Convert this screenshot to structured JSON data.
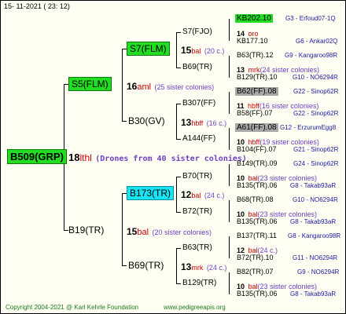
{
  "header": {
    "date": "15- 11-2021 ( 23: 12)"
  },
  "footer": {
    "copyright": "Copyright 2004-2021 @ Karl Kehrle Foundation",
    "site": "www.pedigreeapis.org"
  },
  "root": {
    "name": "B509(GRP)",
    "num": "18",
    "lab": "lthl",
    "drones": "(Drones from 40 sister colonies)"
  },
  "gen2": [
    {
      "name": "S5(FLM)",
      "num": "16",
      "lab": "aml",
      "ann": "(25 sister colonies)"
    },
    {
      "name": "B19(TR)",
      "num": "15",
      "lab": "bal",
      "ann": "(20 sister colonies)"
    }
  ],
  "gen3": [
    {
      "name": "S7(FLM)",
      "num": "15",
      "lab": "bal",
      "ann": "(20 c.)"
    },
    {
      "name": "B30(GV)",
      "num": "13",
      "lab": "hbff",
      "ann": "(16 c.)"
    },
    {
      "name": "B173(TR)",
      "num": "12",
      "lab": "bal",
      "ann": "(24 c.)"
    },
    {
      "name": "B69(TR)",
      "num": "13",
      "lab": "mrk",
      "ann": "(24 c.)"
    }
  ],
  "gen4": [
    {
      "name": "S7(FJO)",
      "num": "14",
      "lab": "oro",
      "ann": ""
    },
    {
      "name": "B69(TR)",
      "num": "13",
      "lab": "mrk",
      "ann": "(24 sister colonies)"
    },
    {
      "name": "B307(FF)",
      "num": "11",
      "lab": "hbff",
      "ann": "(16 sister colonies)"
    },
    {
      "name": "A144(FF)",
      "num": "10",
      "lab": "hbff",
      "ann": "(19 sister colonies)"
    },
    {
      "name": "B70(TR)",
      "num": "10",
      "lab": "bal",
      "ann": "(23 sister colonies)"
    },
    {
      "name": "B72(TR)",
      "num": "10",
      "lab": "bal",
      "ann": "(23 sister colonies)"
    },
    {
      "name": "B63(TR)",
      "num": "12",
      "lab": "bal",
      "ann": "(24 c.)"
    },
    {
      "name": "B129(TR)",
      "num": "10",
      "lab": "bal",
      "ann": "(23 sister colonies)"
    }
  ],
  "gen5": [
    {
      "name": "KB202.10",
      "right": "G3 - Erfoud07-1Q"
    },
    {
      "name": "KB177.10",
      "right": "G6 - Ankar02Q"
    },
    {
      "name": "B63(TR).12",
      "right": "G9 - Kangaroo98R"
    },
    {
      "name": "B129(TR).10",
      "right": "G10 - NO6294R"
    },
    {
      "name": "B62(FF).08",
      "right": "G22 - Sinop62R"
    },
    {
      "name": "B58(FF).07",
      "right": "G22 - Sinop62R"
    },
    {
      "name": "A61(FF).08",
      "right": "G12 - ErzurumEgg8"
    },
    {
      "name": "B104(FF).07",
      "right": "G21 - Sinop62R"
    },
    {
      "name": "B149(TR).09",
      "right": "G24 - Sinop62R"
    },
    {
      "name": "B135(TR).06",
      "right": "G8 - Takab93aR"
    },
    {
      "name": "B68(TR).08",
      "right": "G10 - NO6294R"
    },
    {
      "name": "B135(TR).06",
      "right": "G8 - Takab93aR"
    },
    {
      "name": "B137(TR).11",
      "right": "G8 - Kangaroo98R"
    },
    {
      "name": "B72(TR).10",
      "right": "G11 - NO6294R"
    },
    {
      "name": "B82(TR).07",
      "right": "G9 - NO6294R"
    },
    {
      "name": "B135(TR).06",
      "right": "G8 - Takab93aR"
    }
  ],
  "colors": {
    "green": "#22dd22",
    "cyan": "#15e5f5",
    "gray": "#a8a8a8",
    "red": "#cc0000",
    "purple": "#6e3ec5",
    "blue": "#1a1a9f",
    "footer": "#1a7a1a"
  }
}
